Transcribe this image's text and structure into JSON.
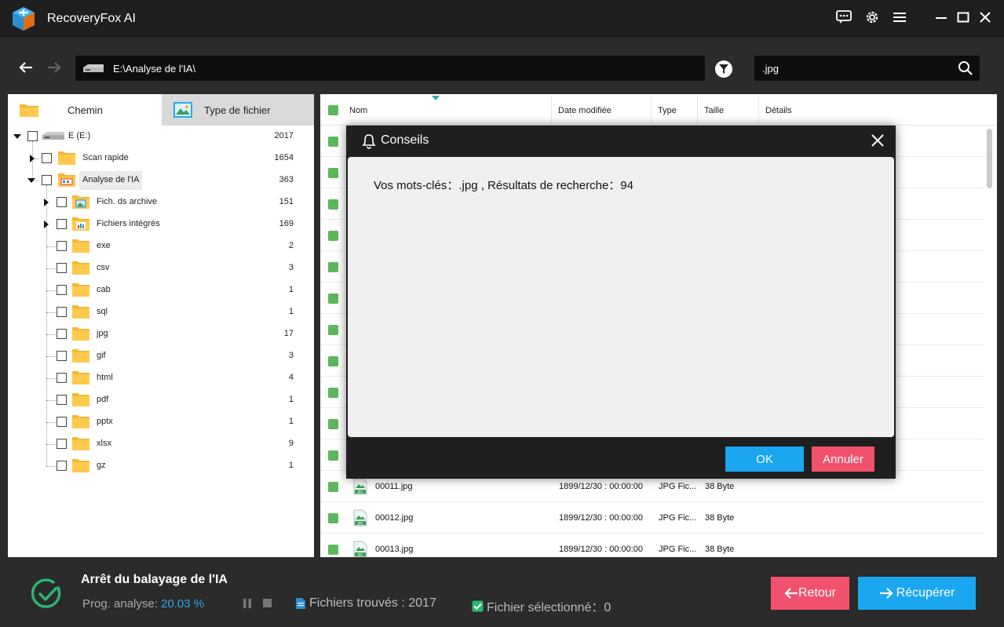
{
  "app": {
    "title": "RecoveryFox AI"
  },
  "titlebar": {
    "icons": [
      "chat-icon",
      "gear-icon",
      "menu-icon",
      "minimize-icon",
      "maximize-icon",
      "close-icon"
    ]
  },
  "nav": {
    "path": "E:\\Analyse de l'IA\\",
    "search_value": ".jpg"
  },
  "left_panel": {
    "tabs": [
      {
        "label": "Chemin",
        "active": true
      },
      {
        "label": "Type de fichier",
        "active": false
      }
    ],
    "tree": [
      {
        "label": "E (E:)",
        "count": "2017"
      },
      {
        "label": "Scan rapide",
        "count": "1654"
      },
      {
        "label": "Analyse de l'IA",
        "count": "363"
      },
      {
        "label": "Fich. ds archive",
        "count": "151"
      },
      {
        "label": "Fichiers intégrés",
        "count": "169"
      },
      {
        "label": "exe",
        "count": "2"
      },
      {
        "label": "csv",
        "count": "3"
      },
      {
        "label": "cab",
        "count": "1"
      },
      {
        "label": "sql",
        "count": "1"
      },
      {
        "label": "jpg",
        "count": "17"
      },
      {
        "label": "gif",
        "count": "3"
      },
      {
        "label": "html",
        "count": "4"
      },
      {
        "label": "pdf",
        "count": "1"
      },
      {
        "label": "pptx",
        "count": "1"
      },
      {
        "label": "xlsx",
        "count": "9"
      },
      {
        "label": "gz",
        "count": "1"
      }
    ]
  },
  "file_list": {
    "columns": [
      "Nom",
      "Date modifiée",
      "Type",
      "Taille",
      "Détails"
    ],
    "rows": [
      {
        "name": "00011.jpg",
        "date": "1899/12/30 : 00:00:00",
        "type": "JPG Fic...",
        "size": "38 Byte"
      },
      {
        "name": "00012.jpg",
        "date": "1899/12/30 : 00:00:00",
        "type": "JPG Fic...",
        "size": "38 Byte"
      },
      {
        "name": "00013.jpg",
        "date": "1899/12/30 : 00:00:00",
        "type": "JPG Fic...",
        "size": "38 Byte"
      }
    ]
  },
  "bottom": {
    "status_title": "Arrêt du balayage de l'IA",
    "progress_label": "Prog. analyse:",
    "progress_value": "20.03 %",
    "found_label": "Fichiers trouvés : 2017",
    "selected_label": "Fichier sélectionné：0",
    "back_label": "Retour",
    "recover_label": "Récupérer"
  },
  "dialog": {
    "title": "Conseils",
    "message": "Vos mots-clés：.jpg , Résultats de recherche：94",
    "ok_label": "OK",
    "cancel_label": "Annuler"
  },
  "colors": {
    "accent_blue": "#1aa7f0",
    "accent_red": "#f2516d",
    "check_green": "#5cb85c",
    "progress_blue": "#2ea8e6",
    "folder_yellow": "#f5b733"
  }
}
